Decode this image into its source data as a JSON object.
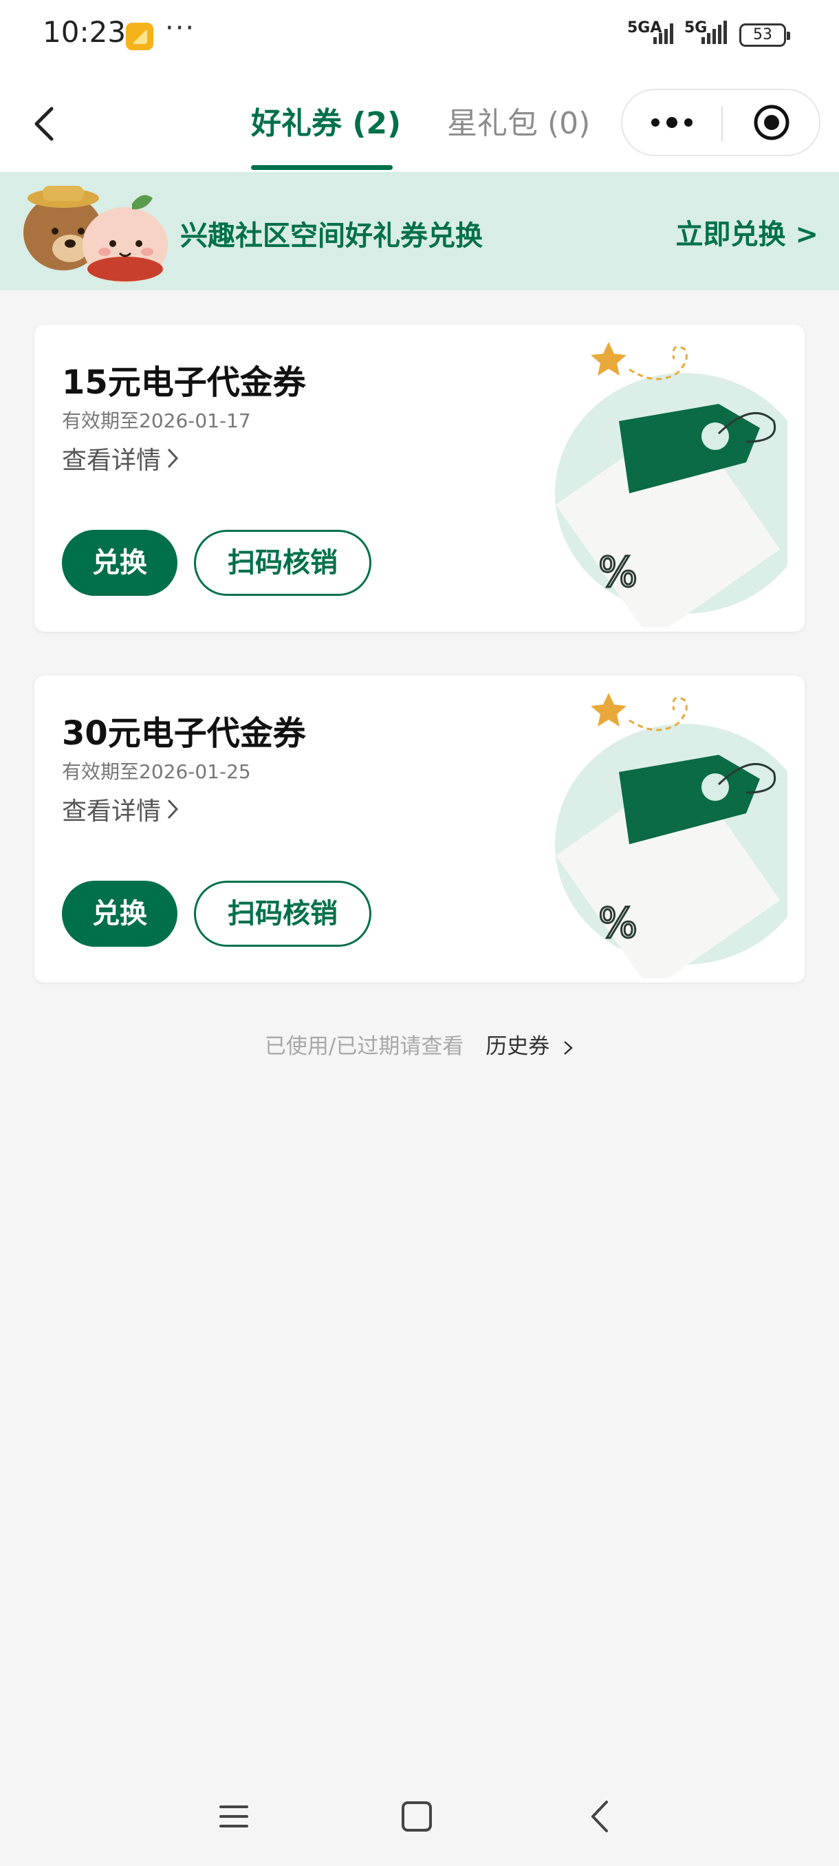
{
  "status_bar": {
    "time": "10:23",
    "more": "···",
    "network": "5GA",
    "network2": "5G",
    "battery": "53"
  },
  "header": {
    "tabs": [
      {
        "label": "好礼券 (2)",
        "active": true
      },
      {
        "label": "星礼包 (0)",
        "active": false
      }
    ],
    "icons": [
      "back-arrow-icon",
      "more-dots-icon",
      "close-circle-icon"
    ]
  },
  "banner": {
    "text": "兴趣社区空间好礼券兑换",
    "action": "立即兑换 >"
  },
  "coupons": [
    {
      "title": "15元电子代金券",
      "expiry": "有效期至2026-01-17",
      "detail": "查看详情",
      "redeem": "兑换",
      "scan": "扫码核销"
    },
    {
      "title": "30元电子代金券",
      "expiry": "有效期至2026-01-25",
      "detail": "查看详情",
      "redeem": "兑换",
      "scan": "扫码核销"
    }
  ],
  "footer": {
    "hint": "已使用/已过期请查看",
    "history": "历史券"
  },
  "colors": {
    "brand": "#00704a",
    "banner_bg": "#d8ede5",
    "page_bg": "#f5f5f5"
  }
}
